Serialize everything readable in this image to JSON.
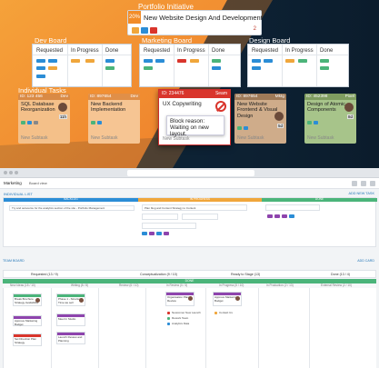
{
  "portfolio": {
    "title": "Portfolio Initiative",
    "card_percent": "20%",
    "card_name": "New Website Design And Development",
    "card_count": "2"
  },
  "boards": [
    {
      "title": "Dev Board",
      "columns": [
        "Requested",
        "In Progress",
        "Done"
      ]
    },
    {
      "title": "Marketing Board",
      "columns": [
        "Requested",
        "In Progress",
        "Done"
      ]
    },
    {
      "title": "Design Board",
      "columns": [
        "Requested",
        "In Progress",
        "Done"
      ]
    }
  ],
  "individual_tasks": {
    "title": "Individual Tasks",
    "cards": [
      {
        "id": "ID: 123 456",
        "tag": "Dev",
        "title": "SQL Database Reorganization",
        "est": "11h",
        "subtasks": "New Subtask",
        "color": "#e8a35f",
        "head": "#d98a45"
      },
      {
        "id": "ID: 897654",
        "tag": "Dev",
        "title": "New Backend Implementation",
        "est": "",
        "subtasks": "New Subtask",
        "color": "#f0a765",
        "head": "#e08f48"
      },
      {
        "id": "ID: 897654",
        "tag": "Mktg",
        "title": "New Website Frontend & Visual Design",
        "est": "5d",
        "subtasks": "New Subtask",
        "color": "#c9a07a",
        "head": "#9e7a58"
      },
      {
        "id": "ID: 452398",
        "tag": "Pixel",
        "title": "Design of Atomic Components",
        "est": "8d",
        "subtasks": "New Subtask",
        "color": "#9ebd7f",
        "head": "#7f9d60"
      }
    ],
    "center": {
      "id": "ID: 234476",
      "tag": "Seam",
      "title": "UX Copywriting",
      "subtasks": "New Subtask",
      "tooltip": "Block reason: Waiting on new layout."
    }
  },
  "app": {
    "toolbar_title": "Marketing",
    "toolbar_view": "Board view",
    "section_title": "INDIVIDUAL LIST",
    "section_link": "ADD NEW TASK",
    "lanes": [
      {
        "label": "BACKLOG",
        "color": "#2b8dd6"
      },
      {
        "label": "IN PROGRESS",
        "color": "#f0a63b"
      },
      {
        "label": "DONE",
        "color": "#4bb47a"
      }
    ],
    "lane_card_text": "Try and outsource for the analytics section of the site - Portfolio Management",
    "lane_card_text2": "Plan blog and Content Strategy to Content",
    "team_board": "TEAM BOARD",
    "team_add": "ADD CARD",
    "column_heads": [
      "Requested (13 / 9)",
      "Conceptualization (9 / 10)",
      "Ready to Stage (13)",
      "Done (13 / 4)"
    ],
    "green_label": "DONE",
    "sub_heads": [
      "New Ideas (15 / 10)",
      "Writing (8 / 8)",
      "Review (6 / 10)",
      "In Review (0 / 3)",
      "In Progress (5 / 10)",
      "In Production (2 / 13)",
      "External Review (2 / 10)"
    ],
    "kcards": [
      "Break Brochure Strategy Availability",
      "Phase 1 - Structure, Time we sell",
      "Meet In Studio",
      "Launch Review and Planning",
      "Organisation Plan Review",
      "Approve Marketing Budget",
      "Set Direction Plan Strategy"
    ],
    "list_rows": [
      "Newcomer New Launch",
      "Rework Team",
      "Analytics Data",
      "Contact Us"
    ]
  },
  "colors": {
    "hero_bg": "#0f2438",
    "orange": "#f28c28",
    "blocked": "#d9352c"
  }
}
